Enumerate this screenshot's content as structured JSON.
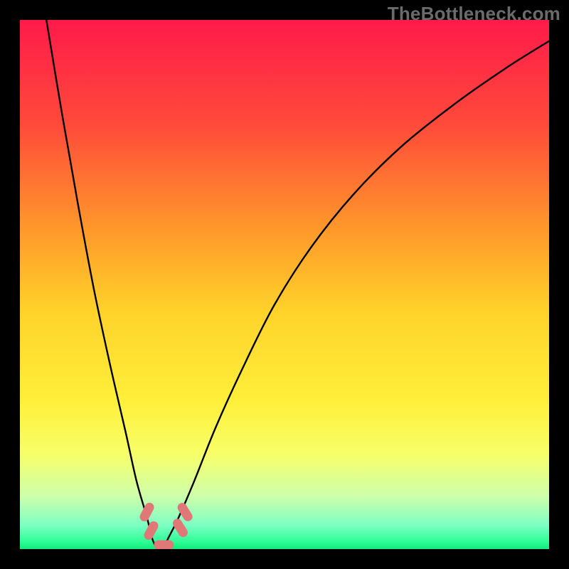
{
  "watermark": "TheBottleneck.com",
  "chart_data": {
    "type": "line",
    "title": "",
    "xlabel": "",
    "ylabel": "",
    "xlim": [
      0,
      100
    ],
    "ylim": [
      0,
      100
    ],
    "grid": false,
    "legend": false,
    "background_gradient": {
      "stops": [
        {
          "offset": 0.0,
          "color": "#ff1a4a"
        },
        {
          "offset": 0.2,
          "color": "#ff4b3a"
        },
        {
          "offset": 0.4,
          "color": "#ff9a2a"
        },
        {
          "offset": 0.55,
          "color": "#ffd22a"
        },
        {
          "offset": 0.72,
          "color": "#ffef3a"
        },
        {
          "offset": 0.82,
          "color": "#f7ff68"
        },
        {
          "offset": 0.9,
          "color": "#ceffab"
        },
        {
          "offset": 0.955,
          "color": "#7dffc4"
        },
        {
          "offset": 0.985,
          "color": "#2fff98"
        },
        {
          "offset": 1.0,
          "color": "#12e97e"
        }
      ]
    },
    "series": [
      {
        "name": "bottleneck-curve",
        "color": "#000000",
        "x": [
          5,
          8,
          11,
          14,
          17,
          20,
          22,
          24,
          25,
          26,
          27,
          28,
          30,
          33,
          37,
          42,
          48,
          55,
          63,
          72,
          82,
          92,
          100
        ],
        "y": [
          100,
          82,
          65,
          49,
          35,
          22,
          13,
          6,
          2,
          0,
          0,
          2,
          6,
          13,
          23,
          34,
          46,
          57,
          67,
          76,
          84,
          91,
          96
        ]
      }
    ],
    "markers": [
      {
        "name": "left-marker-upper",
        "shape": "lozenge",
        "color": "#e07878",
        "x": 24.0,
        "y": 7.0,
        "rot": -62
      },
      {
        "name": "left-marker-lower",
        "shape": "lozenge",
        "color": "#e07878",
        "x": 24.8,
        "y": 3.5,
        "rot": -62
      },
      {
        "name": "bottom-marker",
        "shape": "lozenge",
        "color": "#e07878",
        "x": 27.2,
        "y": 0.8,
        "rot": 0
      },
      {
        "name": "right-marker-lower",
        "shape": "lozenge",
        "color": "#e07878",
        "x": 30.3,
        "y": 4.0,
        "rot": 58
      },
      {
        "name": "right-marker-upper",
        "shape": "lozenge",
        "color": "#e07878",
        "x": 31.2,
        "y": 7.0,
        "rot": 58
      }
    ]
  }
}
